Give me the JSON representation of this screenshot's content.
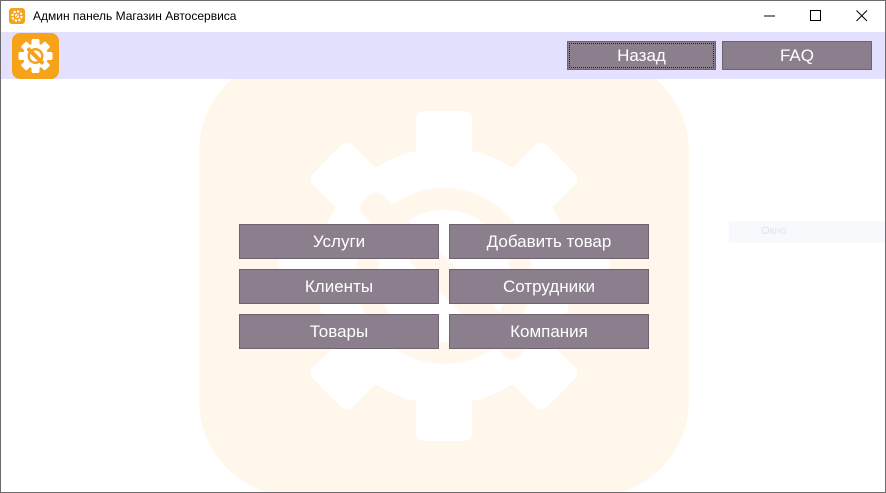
{
  "window": {
    "title": "Админ панель Магазин Автосервиса",
    "icon": "gear-wrench-icon",
    "controls": [
      "minimize-icon",
      "maximize-icon",
      "close-icon"
    ]
  },
  "header": {
    "logo_icon": "gear-wrench-icon",
    "back_label": "Назад",
    "faq_label": "FAQ"
  },
  "menu": {
    "services": "Услуги",
    "add_product": "Добавить товар",
    "clients": "Клиенты",
    "employees": "Сотрудники",
    "products": "Товары",
    "company": "Компания"
  },
  "ghost_label": "Окно",
  "colors": {
    "header_bg": "#e3e1fd",
    "button_bg": "#8b7f8d",
    "accent": "#f7a21b",
    "watermark_bg": "#fff7eb"
  }
}
